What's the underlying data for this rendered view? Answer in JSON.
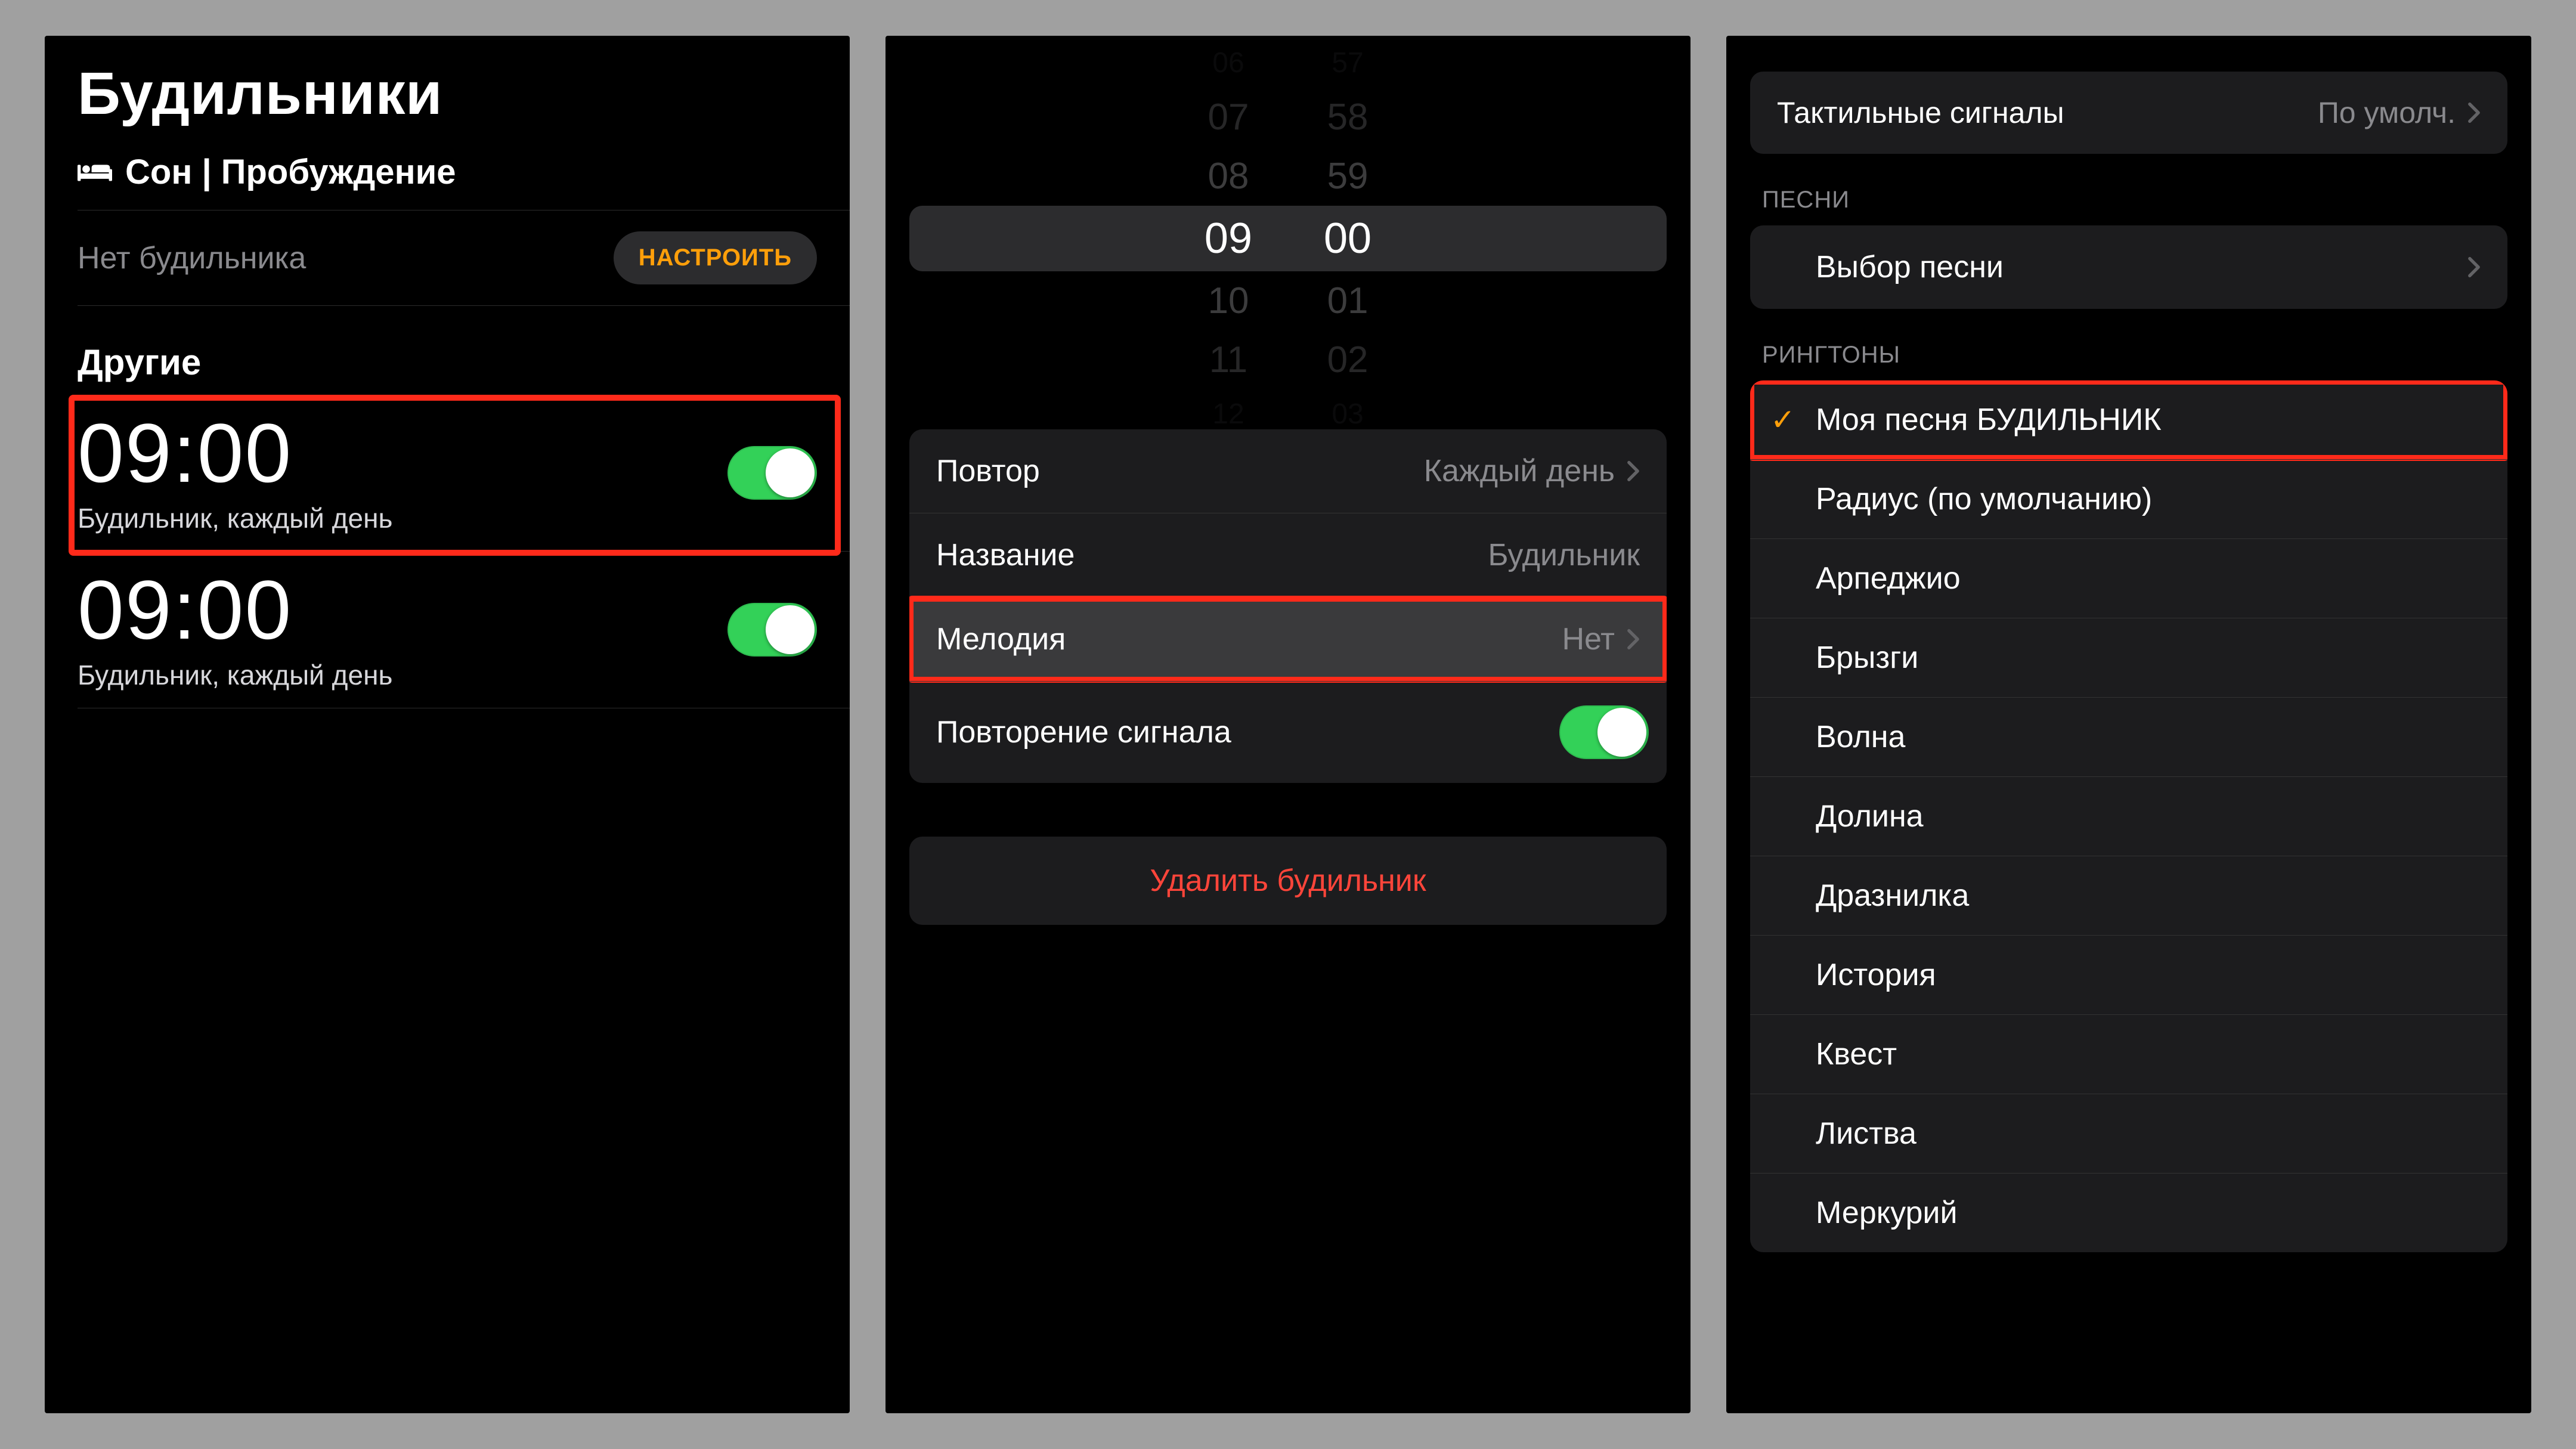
{
  "panel1": {
    "title": "Будильники",
    "sleep_section": "Сон | Пробуждение",
    "no_alarm": "Нет будильника",
    "configure": "НАСТРОИТЬ",
    "others": "Другие",
    "alarms": [
      {
        "time": "09:00",
        "subtitle": "Будильник, каждый день",
        "on": true,
        "highlight": true
      },
      {
        "time": "09:00",
        "subtitle": "Будильник, каждый день",
        "on": true,
        "highlight": false
      }
    ]
  },
  "panel2": {
    "wheel_hours": [
      "06",
      "07",
      "08",
      "09",
      "10",
      "11",
      "12"
    ],
    "wheel_minutes": [
      "57",
      "58",
      "59",
      "00",
      "01",
      "02",
      "03"
    ],
    "rows": {
      "repeat": {
        "label": "Повтор",
        "value": "Каждый день"
      },
      "name": {
        "label": "Название",
        "value": "Будильник"
      },
      "sound": {
        "label": "Мелодия",
        "value": "Нет"
      },
      "snooze": {
        "label": "Повторение сигнала"
      }
    },
    "delete": "Удалить будильник"
  },
  "panel3": {
    "haptics": {
      "label": "Тактильные сигналы",
      "value": "По умолч."
    },
    "songs_head": "ПЕСНИ",
    "pick_song": "Выбор песни",
    "ringtones_head": "РИНГТОНЫ",
    "ringtones": [
      {
        "label": "Моя песня БУДИЛЬНИК",
        "selected": true,
        "highlight": true
      },
      {
        "label": "Радиус (по умолчанию)"
      },
      {
        "label": "Арпеджио"
      },
      {
        "label": "Брызги"
      },
      {
        "label": "Волна"
      },
      {
        "label": "Долина"
      },
      {
        "label": "Дразнилка"
      },
      {
        "label": "История"
      },
      {
        "label": "Квест"
      },
      {
        "label": "Листва"
      },
      {
        "label": "Меркурий"
      }
    ]
  }
}
